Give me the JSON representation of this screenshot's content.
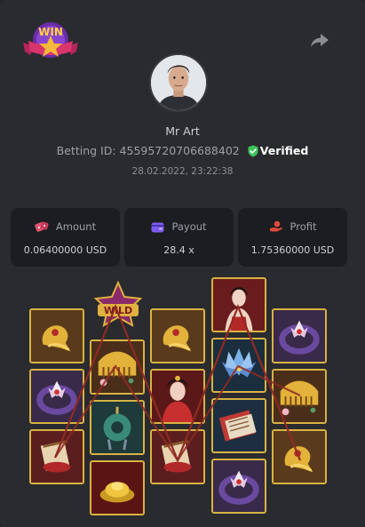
{
  "header": {
    "badge_text": "WIN",
    "share_icon": "share-icon"
  },
  "profile": {
    "name": "Mr Art",
    "betting_label": "Betting ID:",
    "betting_id": "45595720706688402",
    "verified_label": "Verified",
    "date": "28.02.2022, 23:22:38"
  },
  "stats": {
    "amount": {
      "label": "Amount",
      "value": "0.06400000 USD",
      "icon": "dice-icon",
      "color": "#e0546e"
    },
    "payout": {
      "label": "Payout",
      "value": "28.4 x",
      "icon": "wallet-icon",
      "color": "#7c5cf0"
    },
    "profit": {
      "label": "Profit",
      "value": "1.75360000 USD",
      "icon": "hand-coin-icon",
      "color": "#e14a3a"
    }
  },
  "reels": {
    "wild_text": "WILD",
    "columns": [
      [
        "golden-tiger",
        "lotus-ring",
        "scroll"
      ],
      [
        "hair-comb",
        "jade-pendant",
        "gold-ingot"
      ],
      [
        "golden-tiger",
        "empress",
        "scroll"
      ],
      [
        "maiden",
        "blue-lotus",
        "book",
        "lotus-ring"
      ],
      [
        "lotus-ring",
        "hair-comb",
        "golden-tiger"
      ]
    ],
    "line_color": "#8f2a22"
  },
  "colors": {
    "background": "#2a2b2f",
    "panel": "#1c1d20",
    "verified": "#3ec35a",
    "frame": "#d8b343"
  }
}
